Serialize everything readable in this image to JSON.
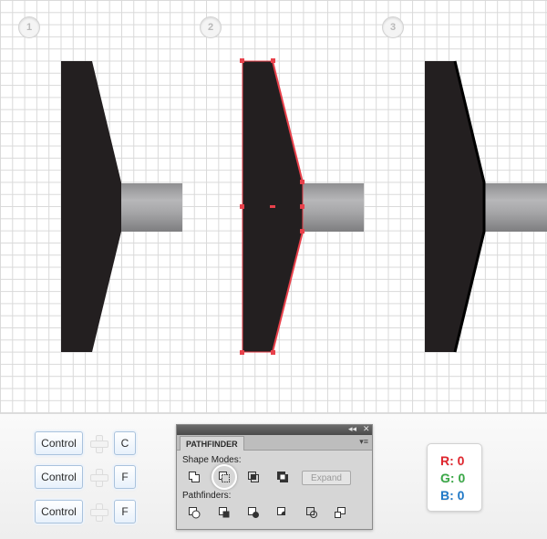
{
  "steps": [
    "1",
    "2",
    "3"
  ],
  "colors": {
    "shape_fill": "#231f20",
    "selection": "#e8414b",
    "grid": "#d9d9d9",
    "red_label": "#e0262e",
    "green_label": "#3aa847",
    "blue_label": "#1f79c8"
  },
  "shortcuts": [
    {
      "modifier": "Control",
      "key": "C"
    },
    {
      "modifier": "Control",
      "key": "F"
    },
    {
      "modifier": "Control",
      "key": "F"
    }
  ],
  "pathfinder": {
    "title": "PATHFINDER",
    "shape_modes_label": "Shape Modes:",
    "pathfinders_label": "Pathfinders:",
    "expand_label": "Expand",
    "collapse_glyph": "◂◂",
    "close_glyph": "✕",
    "menu_glyph": "▾≡",
    "shape_mode_icons": [
      "unite-icon",
      "minus-front-icon",
      "intersect-icon",
      "exclude-icon"
    ],
    "pathfinder_icons": [
      "divide-icon",
      "trim-icon",
      "merge-icon",
      "crop-icon",
      "outline-icon",
      "minus-back-icon"
    ],
    "highlighted_icon": "minus-front-icon"
  },
  "rgb": {
    "r": "R: 0",
    "g": "G: 0",
    "b": "B: 0"
  }
}
